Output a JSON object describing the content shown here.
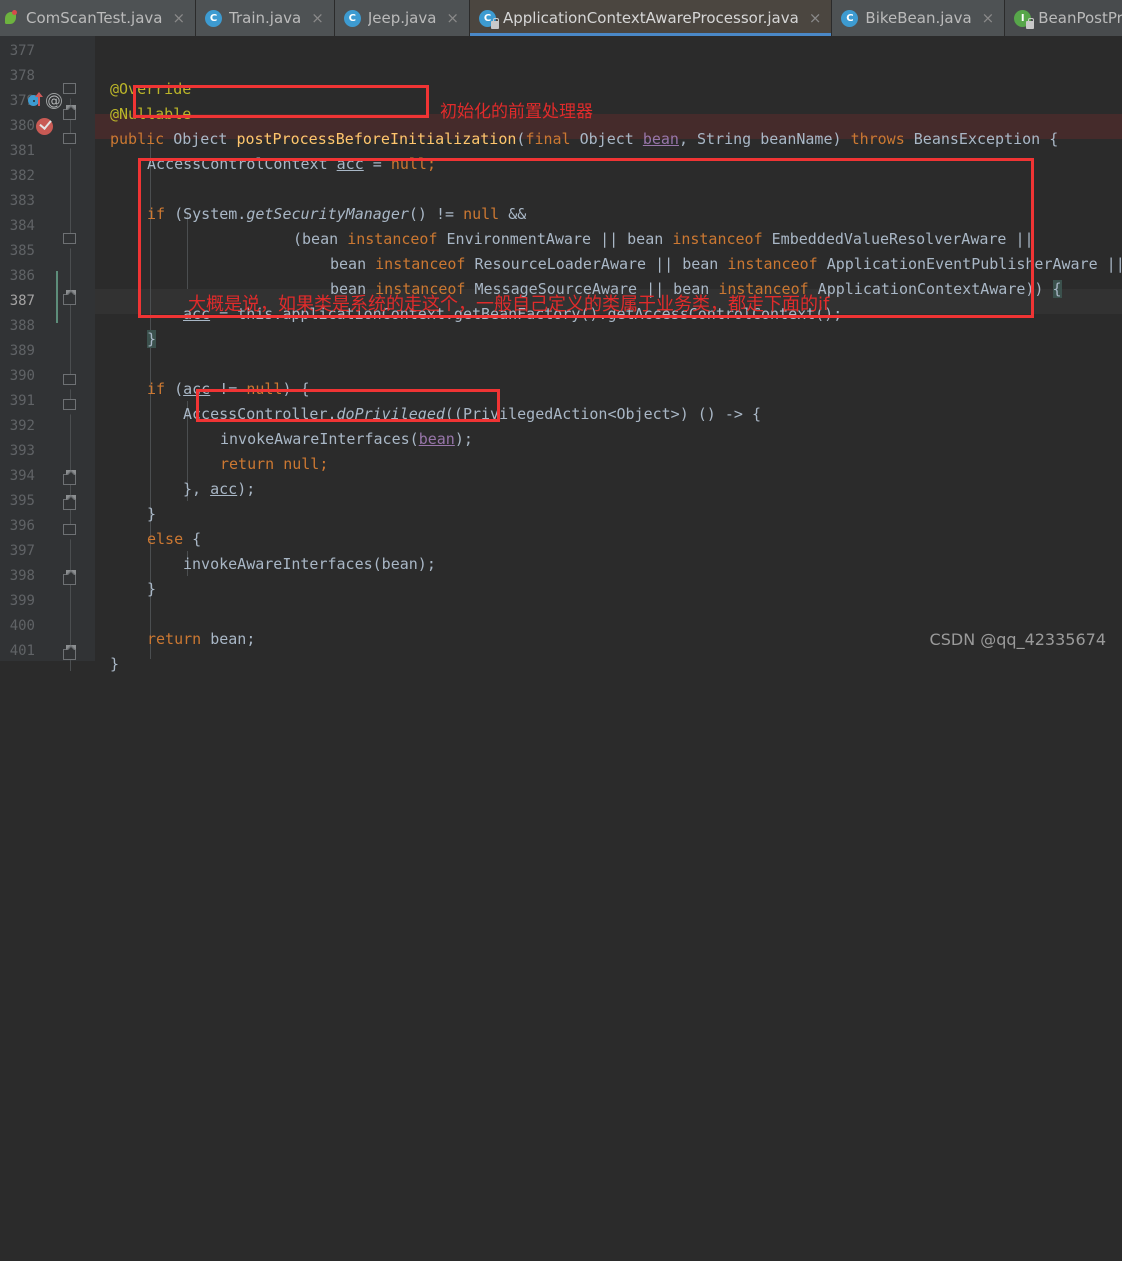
{
  "window": {
    "app": "IntelliJ IDEA Editor",
    "watermark": "CSDN @qq_42335674"
  },
  "tabs": [
    {
      "label": "ComScanTest.java",
      "icon": "spring-bean-icon",
      "close": "×",
      "active": false,
      "locked": false
    },
    {
      "label": "Train.java",
      "icon": "java-class-icon",
      "close": "×",
      "active": false,
      "locked": false
    },
    {
      "label": "Jeep.java",
      "icon": "java-class-icon",
      "close": "×",
      "active": false,
      "locked": false
    },
    {
      "label": "ApplicationContextAwareProcessor.java",
      "icon": "java-class-icon",
      "close": "×",
      "active": true,
      "locked": true
    },
    {
      "label": "BikeBean.java",
      "icon": "java-class-icon",
      "close": "×",
      "active": false,
      "locked": false
    },
    {
      "label": "BeanPostProcessor.",
      "icon": "java-interface-icon",
      "close": "",
      "active": false,
      "locked": true
    }
  ],
  "gutter": {
    "line_numbers": [
      "377",
      "378",
      "379",
      "380",
      "381",
      "382",
      "383",
      "384",
      "385",
      "386",
      "387",
      "388",
      "389",
      "390",
      "391",
      "392",
      "393",
      "394",
      "395",
      "396",
      "397",
      "398",
      "399",
      "400",
      "401"
    ],
    "current_line": "387",
    "icons": {
      "override": "override-method-icon",
      "annotation": "@",
      "breakpoint": "breakpoint-verified-icon"
    }
  },
  "code": {
    "lines": [
      {
        "n": "377",
        "text": "    @Override"
      },
      {
        "n": "378",
        "text": "    @Nullable"
      },
      {
        "n": "379",
        "text": "    public Object postProcessBeforeInitialization(final Object bean, String beanName) throws BeansException {"
      },
      {
        "n": "380",
        "text": "        AccessControlContext acc = null;"
      },
      {
        "n": "381",
        "text": ""
      },
      {
        "n": "382",
        "text": "        if (System.getSecurityManager() != null &&"
      },
      {
        "n": "383",
        "text": "                (bean instanceof EnvironmentAware || bean instanceof EmbeddedValueResolverAware ||"
      },
      {
        "n": "384",
        "text": "                        bean instanceof ResourceLoaderAware || bean instanceof ApplicationEventPublisherAware ||"
      },
      {
        "n": "385",
        "text": "                        bean instanceof MessageSourceAware || bean instanceof ApplicationContextAware)) {"
      },
      {
        "n": "386",
        "text": "            acc = this.applicationContext.getBeanFactory().getAccessControlContext();"
      },
      {
        "n": "387",
        "text": "        }"
      },
      {
        "n": "388",
        "text": ""
      },
      {
        "n": "389",
        "text": "        if (acc != null) {"
      },
      {
        "n": "390",
        "text": "            AccessController.doPrivileged((PrivilegedAction<Object>) () -> {"
      },
      {
        "n": "391",
        "text": "                invokeAwareInterfaces(bean);"
      },
      {
        "n": "392",
        "text": "                return null;"
      },
      {
        "n": "393",
        "text": "            }, acc);"
      },
      {
        "n": "394",
        "text": "        }"
      },
      {
        "n": "395",
        "text": "        else {"
      },
      {
        "n": "396",
        "text": "            invokeAwareInterfaces(bean);"
      },
      {
        "n": "397",
        "text": "        }"
      },
      {
        "n": "398",
        "text": ""
      },
      {
        "n": "399",
        "text": "        return bean;"
      },
      {
        "n": "400",
        "text": "    }"
      }
    ]
  },
  "annotations": {
    "method_note": "初始化的前置处理器",
    "block_note": "大概是说，如果类是系统的走这个，一般自己定义的类属于业务类，都走下面的if",
    "box_color": "#f03434",
    "text_color": "#e02b2b"
  },
  "tokens": {
    "l377_anno": "@Override",
    "l378_anno": "@Nullable",
    "l379_public": "public",
    "l379_object": "Object",
    "l379_method": "postProcessBeforeInitialization",
    "l379_open": "(",
    "l379_final": "final",
    "l379_objparam": " Object",
    "l379_bean": "bean",
    "l379_comma": ", ",
    "l379_string": "String",
    "l379_beanname": " beanName) ",
    "l379_throws": "throws",
    "l379_exc": " BeansException {",
    "l380_type": "AccessControlContext ",
    "l380_acc": "acc",
    "l380_eq": " = ",
    "l380_null": "null;",
    "l382_if": "if",
    "l382_sys": " (System.",
    "l382_getsec": "getSecurityManager",
    "l382_paren": "() != ",
    "l382_null": "null",
    "l382_and": " &&",
    "l383_open": "(bean ",
    "l383_inst1": "instanceof",
    "l383_t1": " EnvironmentAware ",
    "l383_or1": "||",
    "l383_bean2": " bean ",
    "l383_inst2": "instanceof",
    "l383_t2": " EmbeddedValueResolverAware ",
    "l383_or2": "||",
    "l384_bean1": "bean ",
    "l384_inst1": "instanceof",
    "l384_t1": " ResourceLoaderAware ",
    "l384_or1": "||",
    "l384_bean2": " bean ",
    "l384_inst2": "instanceof",
    "l384_t2": " ApplicationEventPublisherAware ",
    "l384_or2": "||",
    "l385_bean1": "bean ",
    "l385_inst1": "instanceof",
    "l385_t1": " MessageSourceAware ",
    "l385_or1": "||",
    "l385_bean2": " bean ",
    "l385_inst2": "instanceof",
    "l385_t2": " ApplicationContextAware)) ",
    "l385_brace": "{",
    "l386_acc": "acc",
    "l386_rest": " = this.applicationContext.getBeanFactory().getAccessControlContext();",
    "l387_close": "}",
    "l389_if": "if",
    "l389_open": " (",
    "l389_acc": "acc",
    "l389_cmp": " != ",
    "l389_null": "null",
    "l389_brace": ") {",
    "l390_ac": "AccessController.",
    "l390_dop": "doPrivileged",
    "l390_rest": "((PrivilegedAction<Object>) () -> {",
    "l391_call": "invokeAwareInterfaces(",
    "l391_bean": "bean",
    "l391_end": ");",
    "l392_ret": "return",
    "l392_null": " null;",
    "l393_close": "}, ",
    "l393_acc": "acc",
    "l393_end": ");",
    "l394_close": "}",
    "l395_else": "else",
    "l395_brace": " {",
    "l396_call": "invokeAwareInterfaces(bean);",
    "l397_close": "}",
    "l399_ret": "return",
    "l399_bean": " bean;",
    "l400_close": "}"
  }
}
